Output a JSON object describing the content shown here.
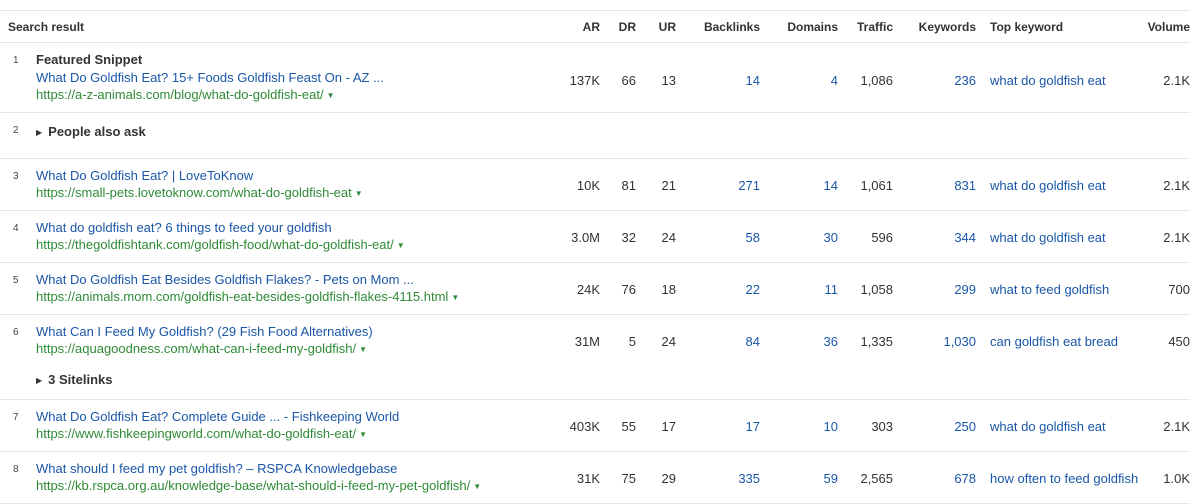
{
  "columns": {
    "search_result": "Search result",
    "ar": "AR",
    "dr": "DR",
    "ur": "UR",
    "backlinks": "Backlinks",
    "domains": "Domains",
    "traffic": "Traffic",
    "keywords": "Keywords",
    "top_keyword": "Top keyword",
    "volume": "Volume"
  },
  "featured": {
    "rank": "1",
    "label": "Featured Snippet",
    "title": "What Do Goldfish Eat? 15+ Foods Goldfish Feast On - AZ ...",
    "url": "https://a-z-animals.com/blog/what-do-goldfish-eat/",
    "ar": "137K",
    "dr": "66",
    "ur": "13",
    "backlinks": "14",
    "domains": "4",
    "traffic": "1,086",
    "keywords": "236",
    "top_keyword": "what do goldfish eat",
    "volume": "2.1K"
  },
  "paa": {
    "rank": "2",
    "label": "People also ask"
  },
  "rows": [
    {
      "rank": "3",
      "title": "What Do Goldfish Eat? | LoveToKnow",
      "url": "https://small-pets.lovetoknow.com/what-do-goldfish-eat",
      "ar": "10K",
      "dr": "81",
      "ur": "21",
      "backlinks": "271",
      "domains": "14",
      "traffic": "1,061",
      "keywords": "831",
      "top_keyword": "what do goldfish eat",
      "volume": "2.1K"
    },
    {
      "rank": "4",
      "title": "What do goldfish eat? 6 things to feed your goldfish",
      "url": "https://thegoldfishtank.com/goldfish-food/what-do-goldfish-eat/",
      "ar": "3.0M",
      "dr": "32",
      "ur": "24",
      "backlinks": "58",
      "domains": "30",
      "traffic": "596",
      "keywords": "344",
      "top_keyword": "what do goldfish eat",
      "volume": "2.1K"
    },
    {
      "rank": "5",
      "title": "What Do Goldfish Eat Besides Goldfish Flakes? - Pets on Mom ...",
      "url": "https://animals.mom.com/goldfish-eat-besides-goldfish-flakes-4115.html",
      "ar": "24K",
      "dr": "76",
      "ur": "18",
      "backlinks": "22",
      "domains": "11",
      "traffic": "1,058",
      "keywords": "299",
      "top_keyword": "what to feed goldfish",
      "volume": "700"
    },
    {
      "rank": "6",
      "title": "What Can I Feed My Goldfish? (29 Fish Food Alternatives)",
      "url": "https://aquagoodness.com/what-can-i-feed-my-goldfish/",
      "ar": "31M",
      "dr": "5",
      "ur": "24",
      "backlinks": "84",
      "domains": "36",
      "traffic": "1,335",
      "keywords": "1,030",
      "top_keyword": "can goldfish eat bread",
      "volume": "450"
    }
  ],
  "sitelinks": {
    "label": "3 Sitelinks"
  },
  "rows_after": [
    {
      "rank": "7",
      "title": "What Do Goldfish Eat? Complete Guide ... - Fishkeeping World",
      "url": "https://www.fishkeepingworld.com/what-do-goldfish-eat/",
      "ar": "403K",
      "dr": "55",
      "ur": "17",
      "backlinks": "17",
      "domains": "10",
      "traffic": "303",
      "keywords": "250",
      "top_keyword": "what do goldfish eat",
      "volume": "2.1K"
    },
    {
      "rank": "8",
      "title": "What should I feed my pet goldfish? – RSPCA Knowledgebase",
      "url": "https://kb.rspca.org.au/knowledge-base/what-should-i-feed-my-pet-goldfish/",
      "ar": "31K",
      "dr": "75",
      "ur": "29",
      "backlinks": "335",
      "domains": "59",
      "traffic": "2,565",
      "keywords": "678",
      "top_keyword": "how often to feed goldfish",
      "volume": "1.0K"
    }
  ],
  "icons": {
    "url_dropdown": "caret-down-icon",
    "expand": "caret-right-icon"
  }
}
